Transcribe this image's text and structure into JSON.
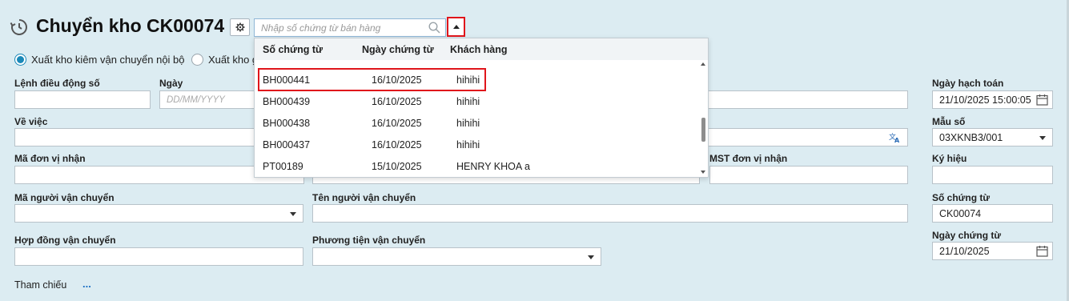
{
  "header": {
    "title": "Chuyển kho CK00074",
    "search_placeholder": "Nhập số chứng từ bán hàng"
  },
  "radios": [
    {
      "label": "Xuất kho kiêm vận chuyển nội bộ",
      "checked": true
    },
    {
      "label": "Xuất kho g",
      "checked": false
    }
  ],
  "form": {
    "lenh_dieu_dong_label": "Lệnh điều động số",
    "lenh_dieu_dong_value": "",
    "ngay_label": "Ngày",
    "ngay_placeholder": "DD/MM/YYYY",
    "ve_viec_label": "Về việc",
    "ma_don_vi_nhan_label": "Mã đơn vị nhận",
    "mst_don_vi_nhan_label": "MST đơn vị nhận",
    "ma_nguoi_van_chuyen_label": "Mã người vận chuyển",
    "ten_nguoi_van_chuyen_label": "Tên người vận chuyển",
    "hop_dong_van_chuyen_label": "Hợp đồng vận chuyển",
    "phuong_tien_van_chuyen_label": "Phương tiện vận chuyển",
    "tham_chieu_label": "Tham chiếu",
    "tham_chieu_link": "..."
  },
  "right_panel": {
    "ngay_hach_toan_label": "Ngày hạch toán",
    "ngay_hach_toan_value": "21/10/2025 15:00:05",
    "mau_so_label": "Mẫu số",
    "mau_so_value": "03XKNB3/001",
    "ky_hieu_label": "Ký hiệu",
    "ky_hieu_value": "",
    "so_chung_tu_label": "Số chứng từ",
    "so_chung_tu_value": "CK00074",
    "ngay_chung_tu_label": "Ngày chứng từ",
    "ngay_chung_tu_value": "21/10/2025"
  },
  "dropdown": {
    "columns": [
      "Số chứng từ",
      "Ngày chứng từ",
      "Khách hàng"
    ],
    "rows": [
      {
        "so": "BH000441",
        "ngay": "16/10/2025",
        "khach": "hihihi"
      },
      {
        "so": "BH000439",
        "ngay": "16/10/2025",
        "khach": "hihihi"
      },
      {
        "so": "BH000438",
        "ngay": "16/10/2025",
        "khach": "hihihi"
      },
      {
        "so": "BH000437",
        "ngay": "16/10/2025",
        "khach": "hihihi"
      },
      {
        "so": "PT00189",
        "ngay": "15/10/2025",
        "khach": "HENRY KHOA a"
      }
    ]
  },
  "colors": {
    "accent": "#1a88b8",
    "highlight": "#e0151b",
    "background": "#dcecf2"
  }
}
